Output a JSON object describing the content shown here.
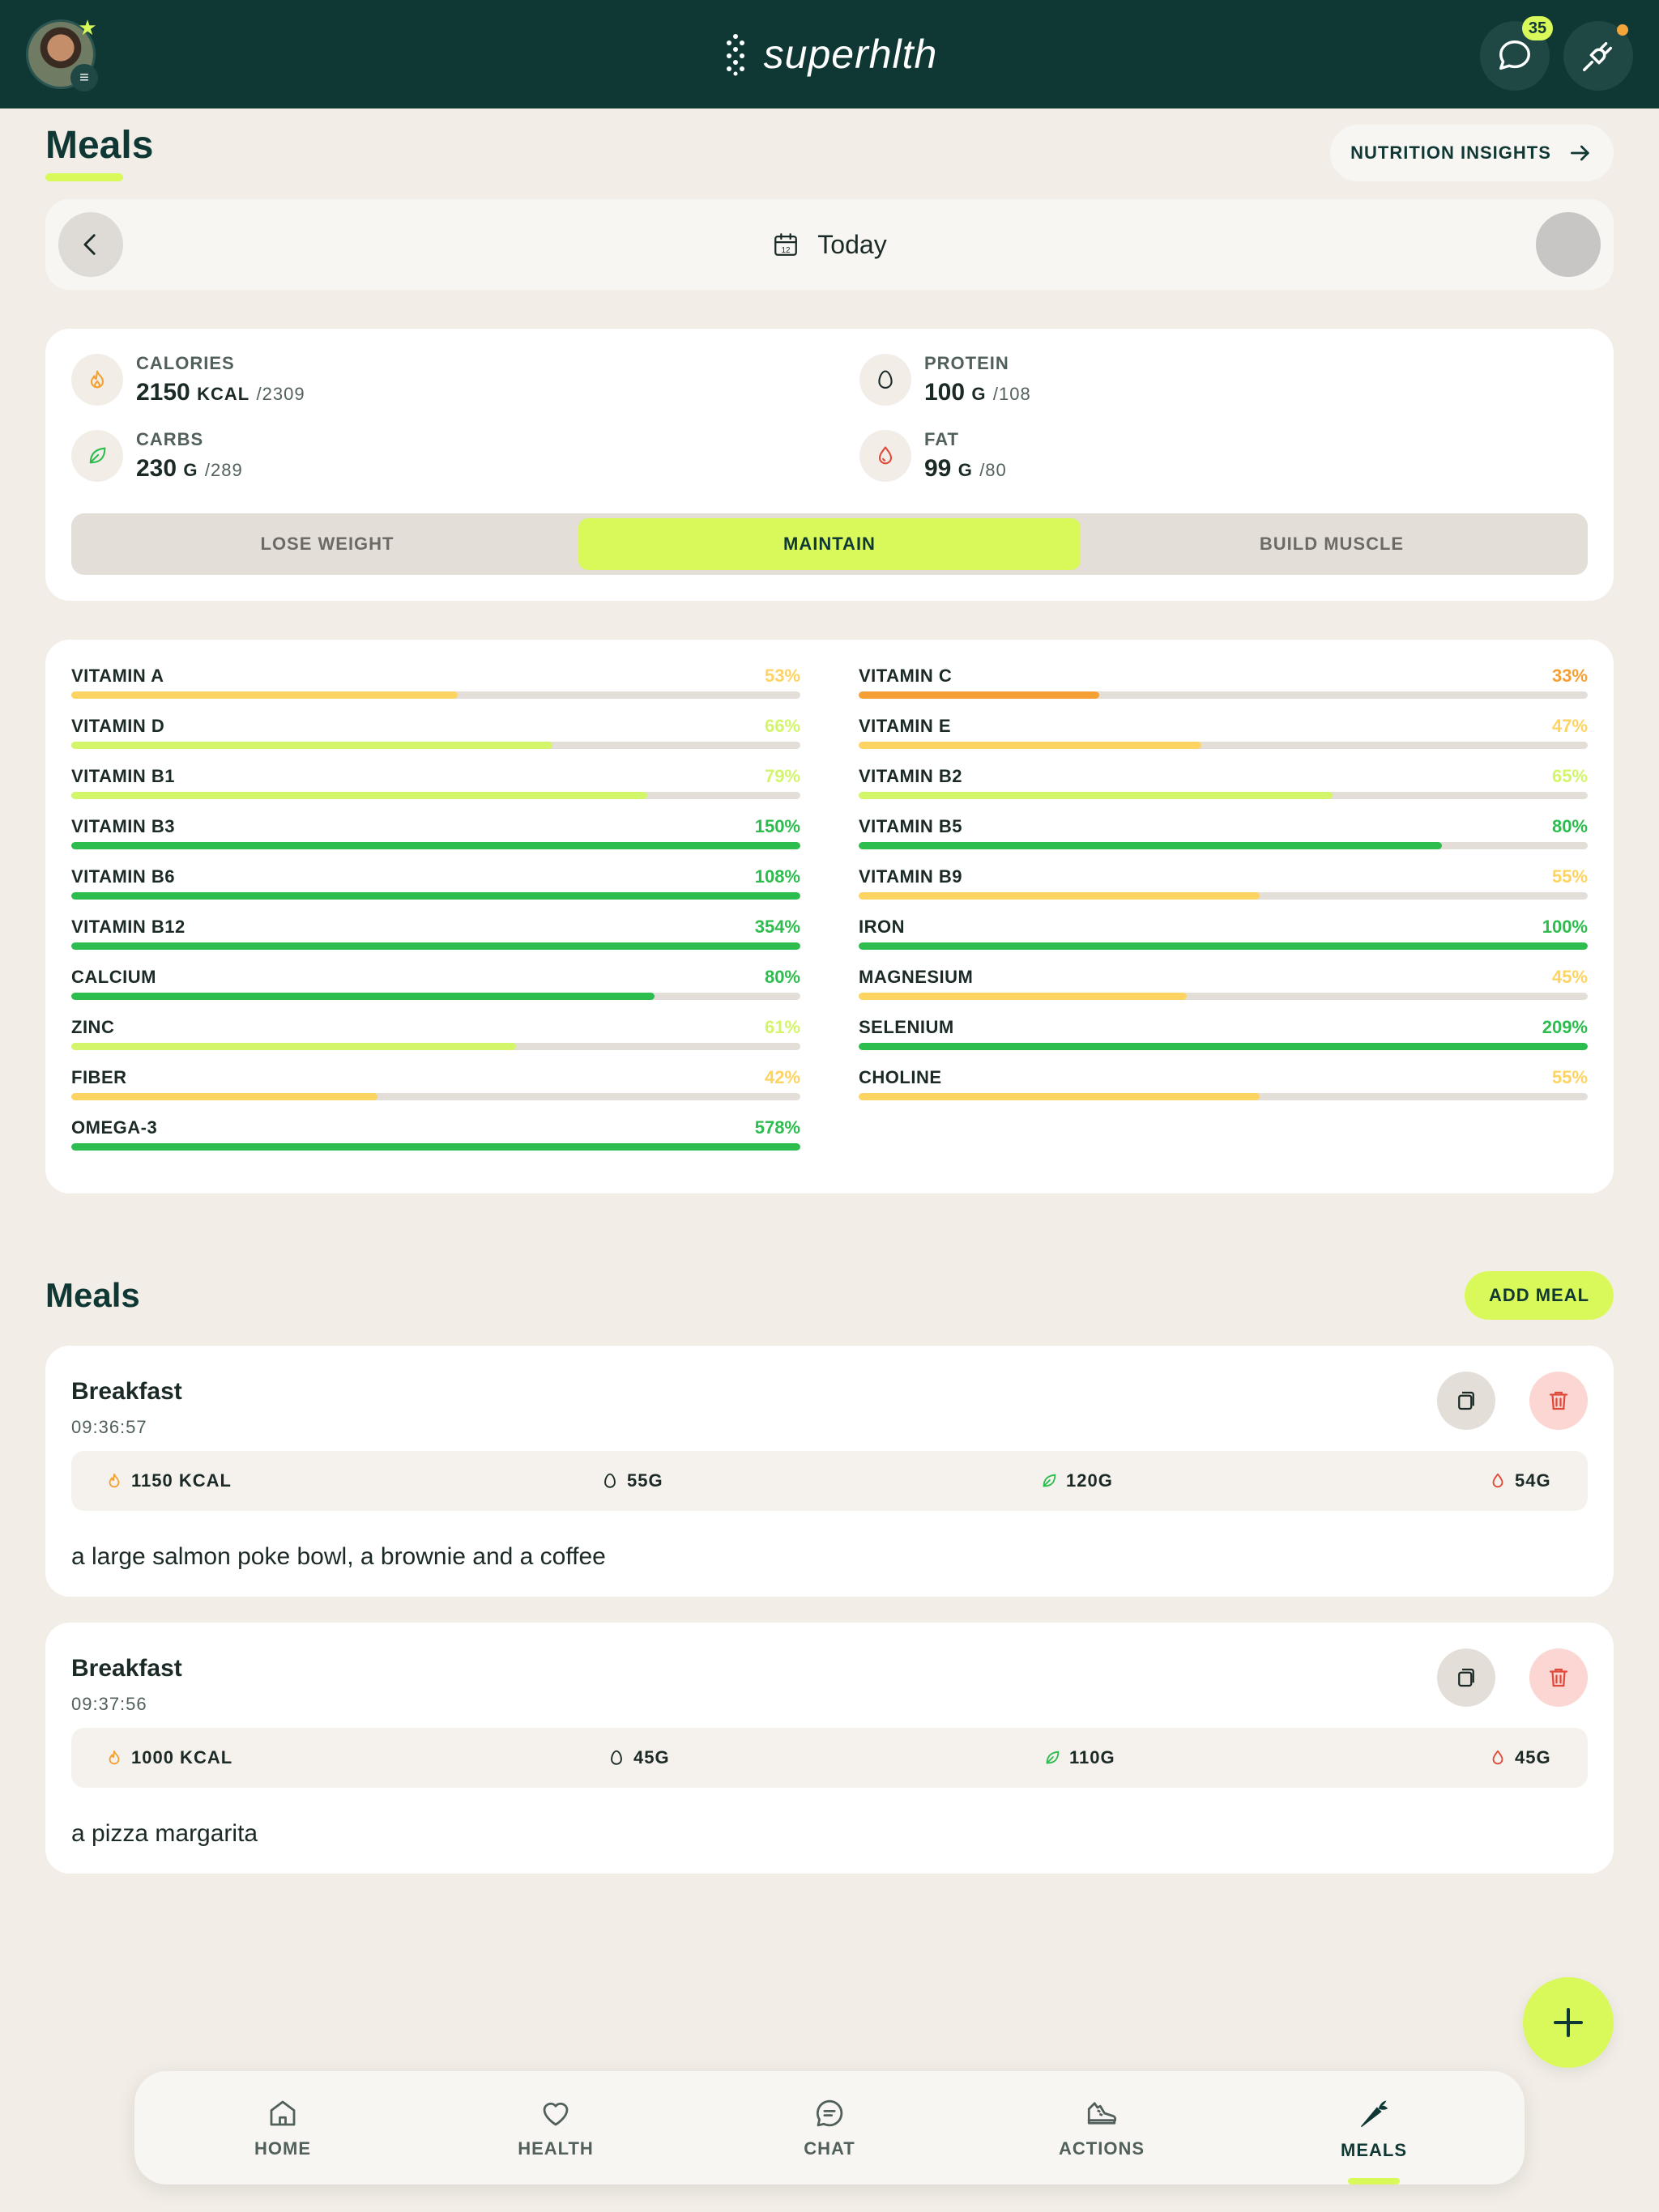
{
  "app": {
    "logo_text": "superhlth",
    "chat_badge": "35"
  },
  "page": {
    "title": "Meals",
    "insights_label": "NUTRITION INSIGHTS"
  },
  "date": {
    "label": "Today",
    "calendar_day": "12"
  },
  "macros": {
    "calories": {
      "label": "CALORIES",
      "value": "2150",
      "unit": "KCAL",
      "goal": "/2309"
    },
    "protein": {
      "label": "PROTEIN",
      "value": "100",
      "unit": "G",
      "goal": "/108"
    },
    "carbs": {
      "label": "CARBS",
      "value": "230",
      "unit": "G",
      "goal": "/289"
    },
    "fat": {
      "label": "FAT",
      "value": "99",
      "unit": "G",
      "goal": "/80"
    }
  },
  "goals": [
    "LOSE WEIGHT",
    "MAINTAIN",
    "BUILD MUSCLE"
  ],
  "goal_selected": "MAINTAIN",
  "colors": {
    "green": "#2dbd4f",
    "lime": "#d3f56a",
    "yellow": "#fdd462",
    "orange": "#f5a034",
    "track": "#e3dfd8"
  },
  "nutrients": [
    {
      "name": "VITAMIN A",
      "pct": "53%",
      "fill": 0.53,
      "color": "yellow"
    },
    {
      "name": "VITAMIN C",
      "pct": "33%",
      "fill": 0.33,
      "color": "orange"
    },
    {
      "name": "VITAMIN D",
      "pct": "66%",
      "fill": 0.66,
      "color": "lime"
    },
    {
      "name": "VITAMIN E",
      "pct": "47%",
      "fill": 0.47,
      "color": "yellow"
    },
    {
      "name": "VITAMIN B1",
      "pct": "79%",
      "fill": 0.79,
      "color": "lime"
    },
    {
      "name": "VITAMIN B2",
      "pct": "65%",
      "fill": 0.65,
      "color": "lime"
    },
    {
      "name": "VITAMIN B3",
      "pct": "150%",
      "fill": 1.0,
      "color": "green"
    },
    {
      "name": "VITAMIN B5",
      "pct": "80%",
      "fill": 0.8,
      "color": "green"
    },
    {
      "name": "VITAMIN B6",
      "pct": "108%",
      "fill": 1.0,
      "color": "green"
    },
    {
      "name": "VITAMIN B9",
      "pct": "55%",
      "fill": 0.55,
      "color": "yellow"
    },
    {
      "name": "VITAMIN B12",
      "pct": "354%",
      "fill": 1.0,
      "color": "green"
    },
    {
      "name": "IRON",
      "pct": "100%",
      "fill": 1.0,
      "color": "green"
    },
    {
      "name": "CALCIUM",
      "pct": "80%",
      "fill": 0.8,
      "color": "green"
    },
    {
      "name": "MAGNESIUM",
      "pct": "45%",
      "fill": 0.45,
      "color": "yellow"
    },
    {
      "name": "ZINC",
      "pct": "61%",
      "fill": 0.61,
      "color": "lime"
    },
    {
      "name": "SELENIUM",
      "pct": "209%",
      "fill": 1.0,
      "color": "green"
    },
    {
      "name": "FIBER",
      "pct": "42%",
      "fill": 0.42,
      "color": "yellow"
    },
    {
      "name": "CHOLINE",
      "pct": "55%",
      "fill": 0.55,
      "color": "yellow"
    },
    {
      "name": "OMEGA-3",
      "pct": "578%",
      "fill": 1.0,
      "color": "green"
    }
  ],
  "meals_section": {
    "title": "Meals",
    "add_label": "ADD MEAL"
  },
  "meals": [
    {
      "title": "Breakfast",
      "time": "09:36:57",
      "kcal": "1150 KCAL",
      "protein": "55G",
      "carbs": "120G",
      "fat": "54G",
      "description": "a large salmon poke bowl, a brownie and a coffee"
    },
    {
      "title": "Breakfast",
      "time": "09:37:56",
      "kcal": "1000 KCAL",
      "protein": "45G",
      "carbs": "110G",
      "fat": "45G",
      "description": "a pizza margarita"
    }
  ],
  "nav": {
    "home": "HOME",
    "health": "HEALTH",
    "chat": "CHAT",
    "actions": "ACTIONS",
    "meals": "MEALS",
    "active": "MEALS"
  }
}
